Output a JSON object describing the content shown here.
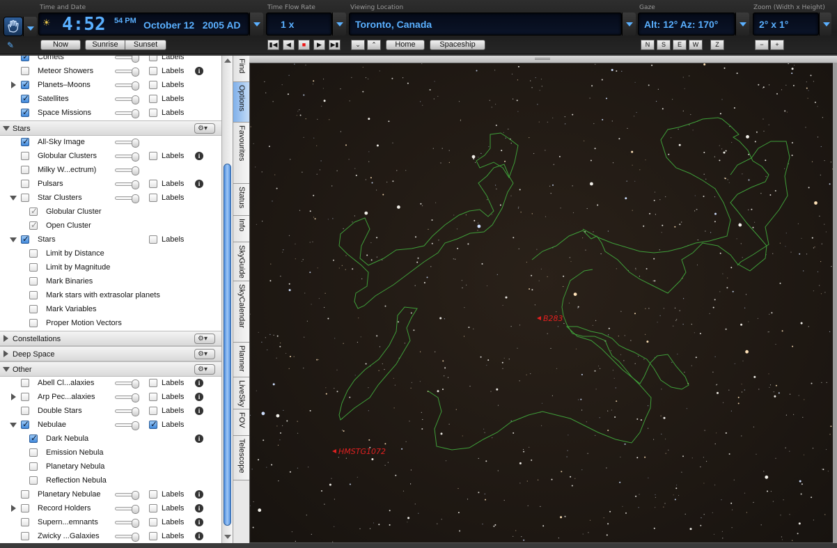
{
  "toolbar": {
    "time_date_label": "Time and Date",
    "time": "4:52",
    "seconds_ampm": "54 PM",
    "date": "October 12   2005 AD",
    "flow_label": "Time Flow Rate",
    "flow_value": "1 x",
    "location_label": "Viewing Location",
    "location_value": "Toronto, Canada",
    "gaze_label": "Gaze",
    "gaze_value": "Alt: 12° Az: 170°",
    "zoom_label": "Zoom (Width x Height)",
    "zoom_value": "2° x 1°",
    "now": "Now",
    "sunrise": "Sunrise",
    "sunset": "Sunset",
    "home": "Home",
    "spaceship": "Spaceship",
    "dirs": [
      "N",
      "S",
      "E",
      "W",
      "Z"
    ],
    "zoom_minus": "−",
    "zoom_plus": "+"
  },
  "sidebar": {
    "labels_text": "Labels",
    "solar": [
      {
        "name": "Comets",
        "checked": true,
        "slider": true,
        "labels": true,
        "info": false
      },
      {
        "name": "Meteor Showers",
        "checked": false,
        "slider": true,
        "labels": true,
        "info": true
      },
      {
        "name": "Planets–Moons",
        "checked": true,
        "slider": true,
        "labels": true,
        "info": false,
        "expander": "right"
      },
      {
        "name": "Satellites",
        "checked": true,
        "slider": true,
        "labels": true,
        "info": false
      },
      {
        "name": "Space Missions",
        "checked": true,
        "slider": true,
        "labels": true,
        "info": false
      }
    ],
    "stars_header": "Stars",
    "stars": [
      {
        "name": "All-Sky Image",
        "checked": true,
        "slider": true
      },
      {
        "name": "Globular Clusters",
        "checked": false,
        "slider": true,
        "labels": true,
        "info": true
      },
      {
        "name": "Milky W...ectrum)",
        "checked": false,
        "slider": true
      },
      {
        "name": "Pulsars",
        "checked": false,
        "slider": true,
        "labels": true,
        "info": true
      },
      {
        "name": "Star Clusters",
        "checked": false,
        "slider": true,
        "labels": true,
        "expander": "down"
      },
      {
        "name": "Globular Cluster",
        "checked": "dim",
        "indent": 2
      },
      {
        "name": "Open Cluster",
        "checked": "dim",
        "indent": 2
      },
      {
        "name": "Stars",
        "checked": true,
        "labels": true,
        "expander": "down"
      },
      {
        "name": "Limit by Distance",
        "checked": false,
        "indent": 2
      },
      {
        "name": "Limit by Magnitude",
        "checked": false,
        "indent": 2
      },
      {
        "name": "Mark Binaries",
        "checked": false,
        "indent": 2
      },
      {
        "name": "Mark stars with extrasolar planets",
        "checked": false,
        "indent": 2
      },
      {
        "name": "Mark Variables",
        "checked": false,
        "indent": 2
      },
      {
        "name": "Proper Motion Vectors",
        "checked": false,
        "indent": 2
      }
    ],
    "constellations_header": "Constellations",
    "deepspace_header": "Deep Space",
    "other_header": "Other",
    "other": [
      {
        "name": "Abell Cl...alaxies",
        "checked": false,
        "slider": true,
        "labels": true,
        "info": true
      },
      {
        "name": "Arp Pec...alaxies",
        "checked": false,
        "slider": true,
        "labels": true,
        "info": true,
        "expander": "right"
      },
      {
        "name": "Double Stars",
        "checked": false,
        "slider": true,
        "labels": true,
        "info": true
      },
      {
        "name": "Nebulae",
        "checked": true,
        "slider": true,
        "labels": "on",
        "expander": "down"
      },
      {
        "name": "Dark Nebula",
        "checked": true,
        "indent": 2,
        "info": true
      },
      {
        "name": "Emission Nebula",
        "checked": false,
        "indent": 2
      },
      {
        "name": "Planetary Nebula",
        "checked": false,
        "indent": 2
      },
      {
        "name": "Reflection Nebula",
        "checked": false,
        "indent": 2
      },
      {
        "name": "Planetary Nebulae",
        "checked": false,
        "slider": true,
        "labels": true,
        "info": true
      },
      {
        "name": "Record Holders",
        "checked": false,
        "slider": true,
        "labels": true,
        "info": true,
        "expander": "right"
      },
      {
        "name": "Supern...emnants",
        "checked": false,
        "slider": true,
        "labels": true,
        "info": true
      },
      {
        "name": "Zwicky ...Galaxies",
        "checked": false,
        "slider": true,
        "labels": true,
        "info": true
      }
    ]
  },
  "tabs": [
    "Find",
    "Options",
    "Favourites",
    "Status",
    "Info",
    "SkyGuide",
    "SkyCalendar",
    "Planner",
    "LiveSky",
    "FOV",
    "Telescope"
  ],
  "active_tab": "Options",
  "sky": {
    "labels": [
      "B283",
      "HMSTG1072"
    ],
    "outline_color": "#3fa03a",
    "label_color": "#e02020"
  },
  "colors": {
    "lcd_text": "#5ab0ff",
    "accent": "#3f87da"
  }
}
